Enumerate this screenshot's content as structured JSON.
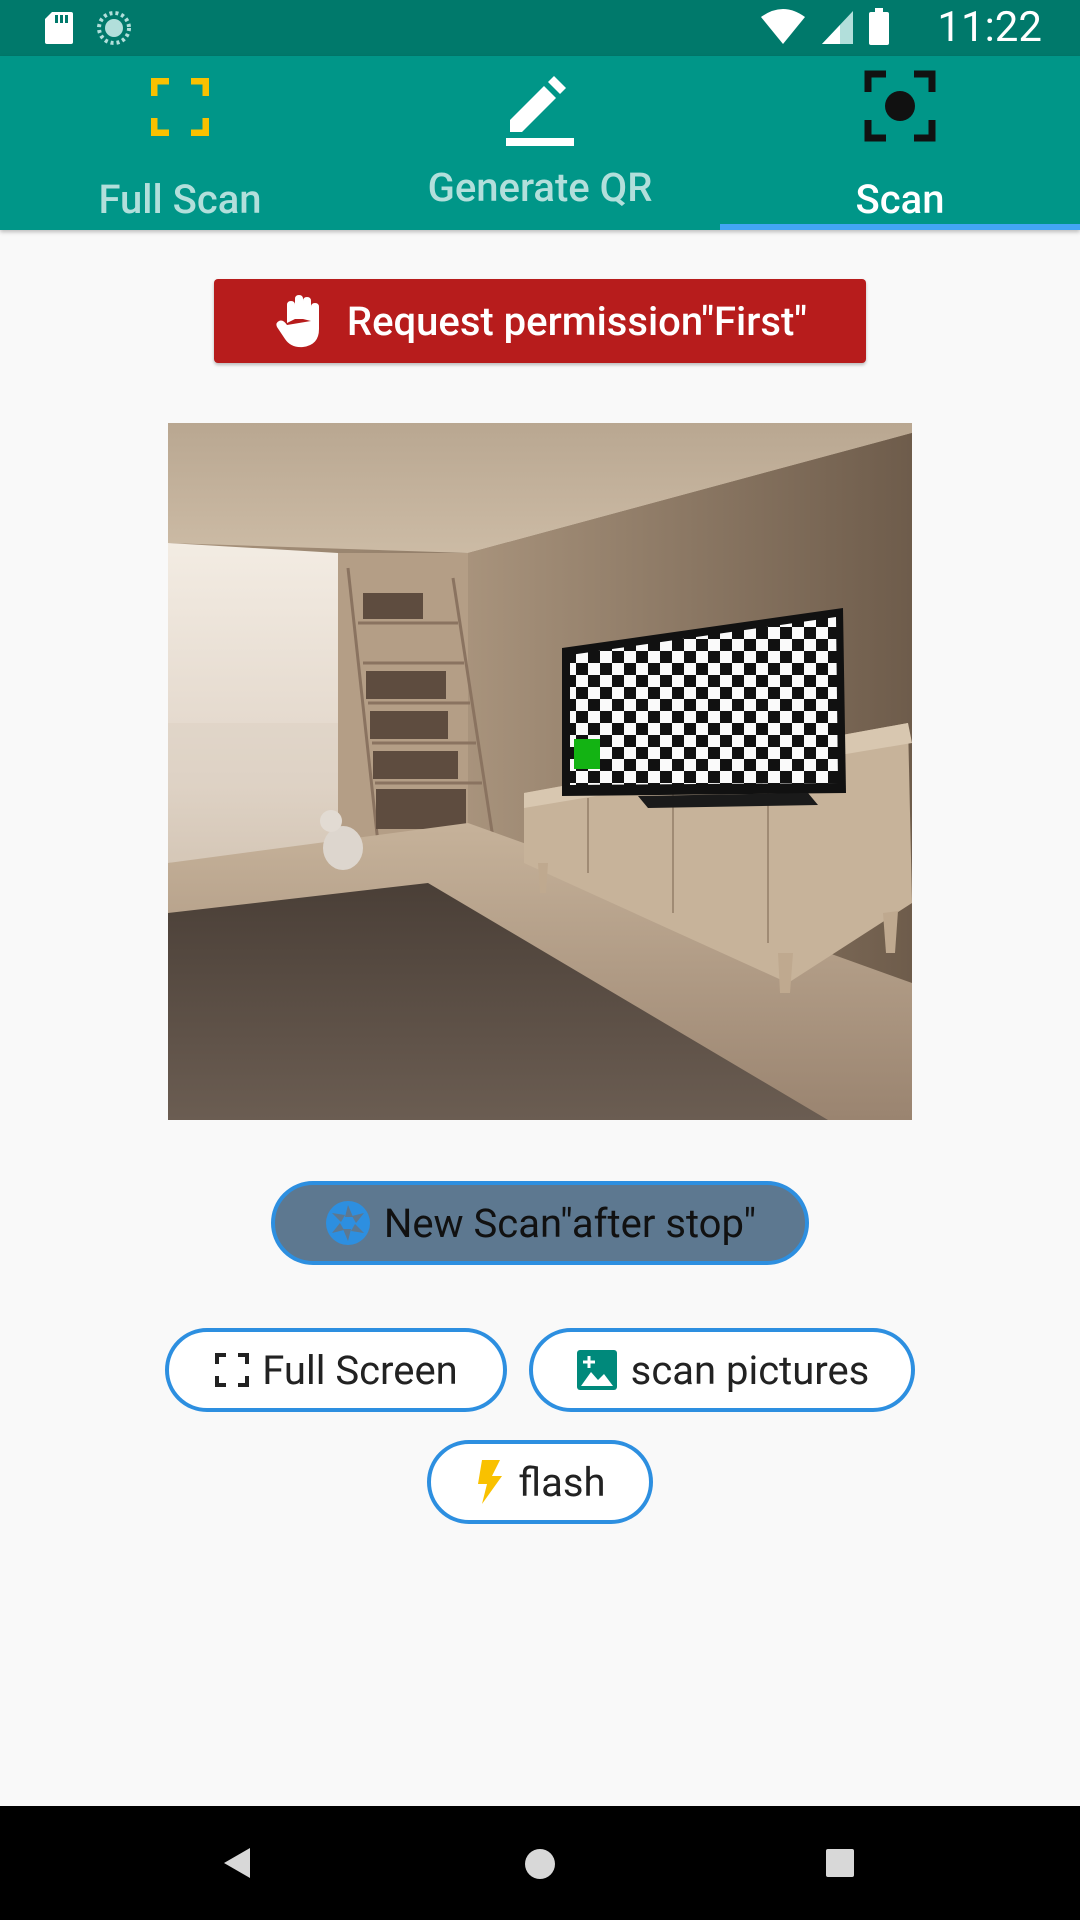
{
  "status_bar": {
    "time": "11:22",
    "left_icons": [
      "sd-card-icon",
      "sync-icon"
    ],
    "right_icons": [
      "wifi-icon",
      "signal-icon",
      "battery-icon"
    ]
  },
  "tabs": [
    {
      "label": "Full Scan",
      "icon": "fullscreen-frame-icon",
      "selected": false
    },
    {
      "label": "Generate QR",
      "icon": "edit-pencil-icon",
      "selected": false
    },
    {
      "label": "Scan",
      "icon": "center-focus-icon",
      "selected": true
    }
  ],
  "permission_button": {
    "label": "Request permission\"First\"",
    "icon": "hand-stop-icon"
  },
  "new_scan_button": {
    "label": "New Scan\"after stop\"",
    "icon": "camera-shutter-icon"
  },
  "fullscreen_button": {
    "label": "Full Screen",
    "icon": "fullscreen-frame-icon"
  },
  "scan_pictures_button": {
    "label": "scan pictures",
    "icon": "image-icon"
  },
  "flash_button": {
    "label": "flash",
    "icon": "flash-bolt-icon"
  },
  "nav_bar": {
    "buttons": [
      "back-icon",
      "home-icon",
      "recents-icon"
    ]
  },
  "colors": {
    "status_bar": "#00796b",
    "app_bar": "#009688",
    "tab_indicator": "#42a5f5",
    "permission_button": "#b71c1c",
    "pill_border": "#2d8fe0",
    "new_scan_fill": "#5d7890",
    "flash_yellow": "#f9c100",
    "image_icon_teal": "#00897b"
  }
}
